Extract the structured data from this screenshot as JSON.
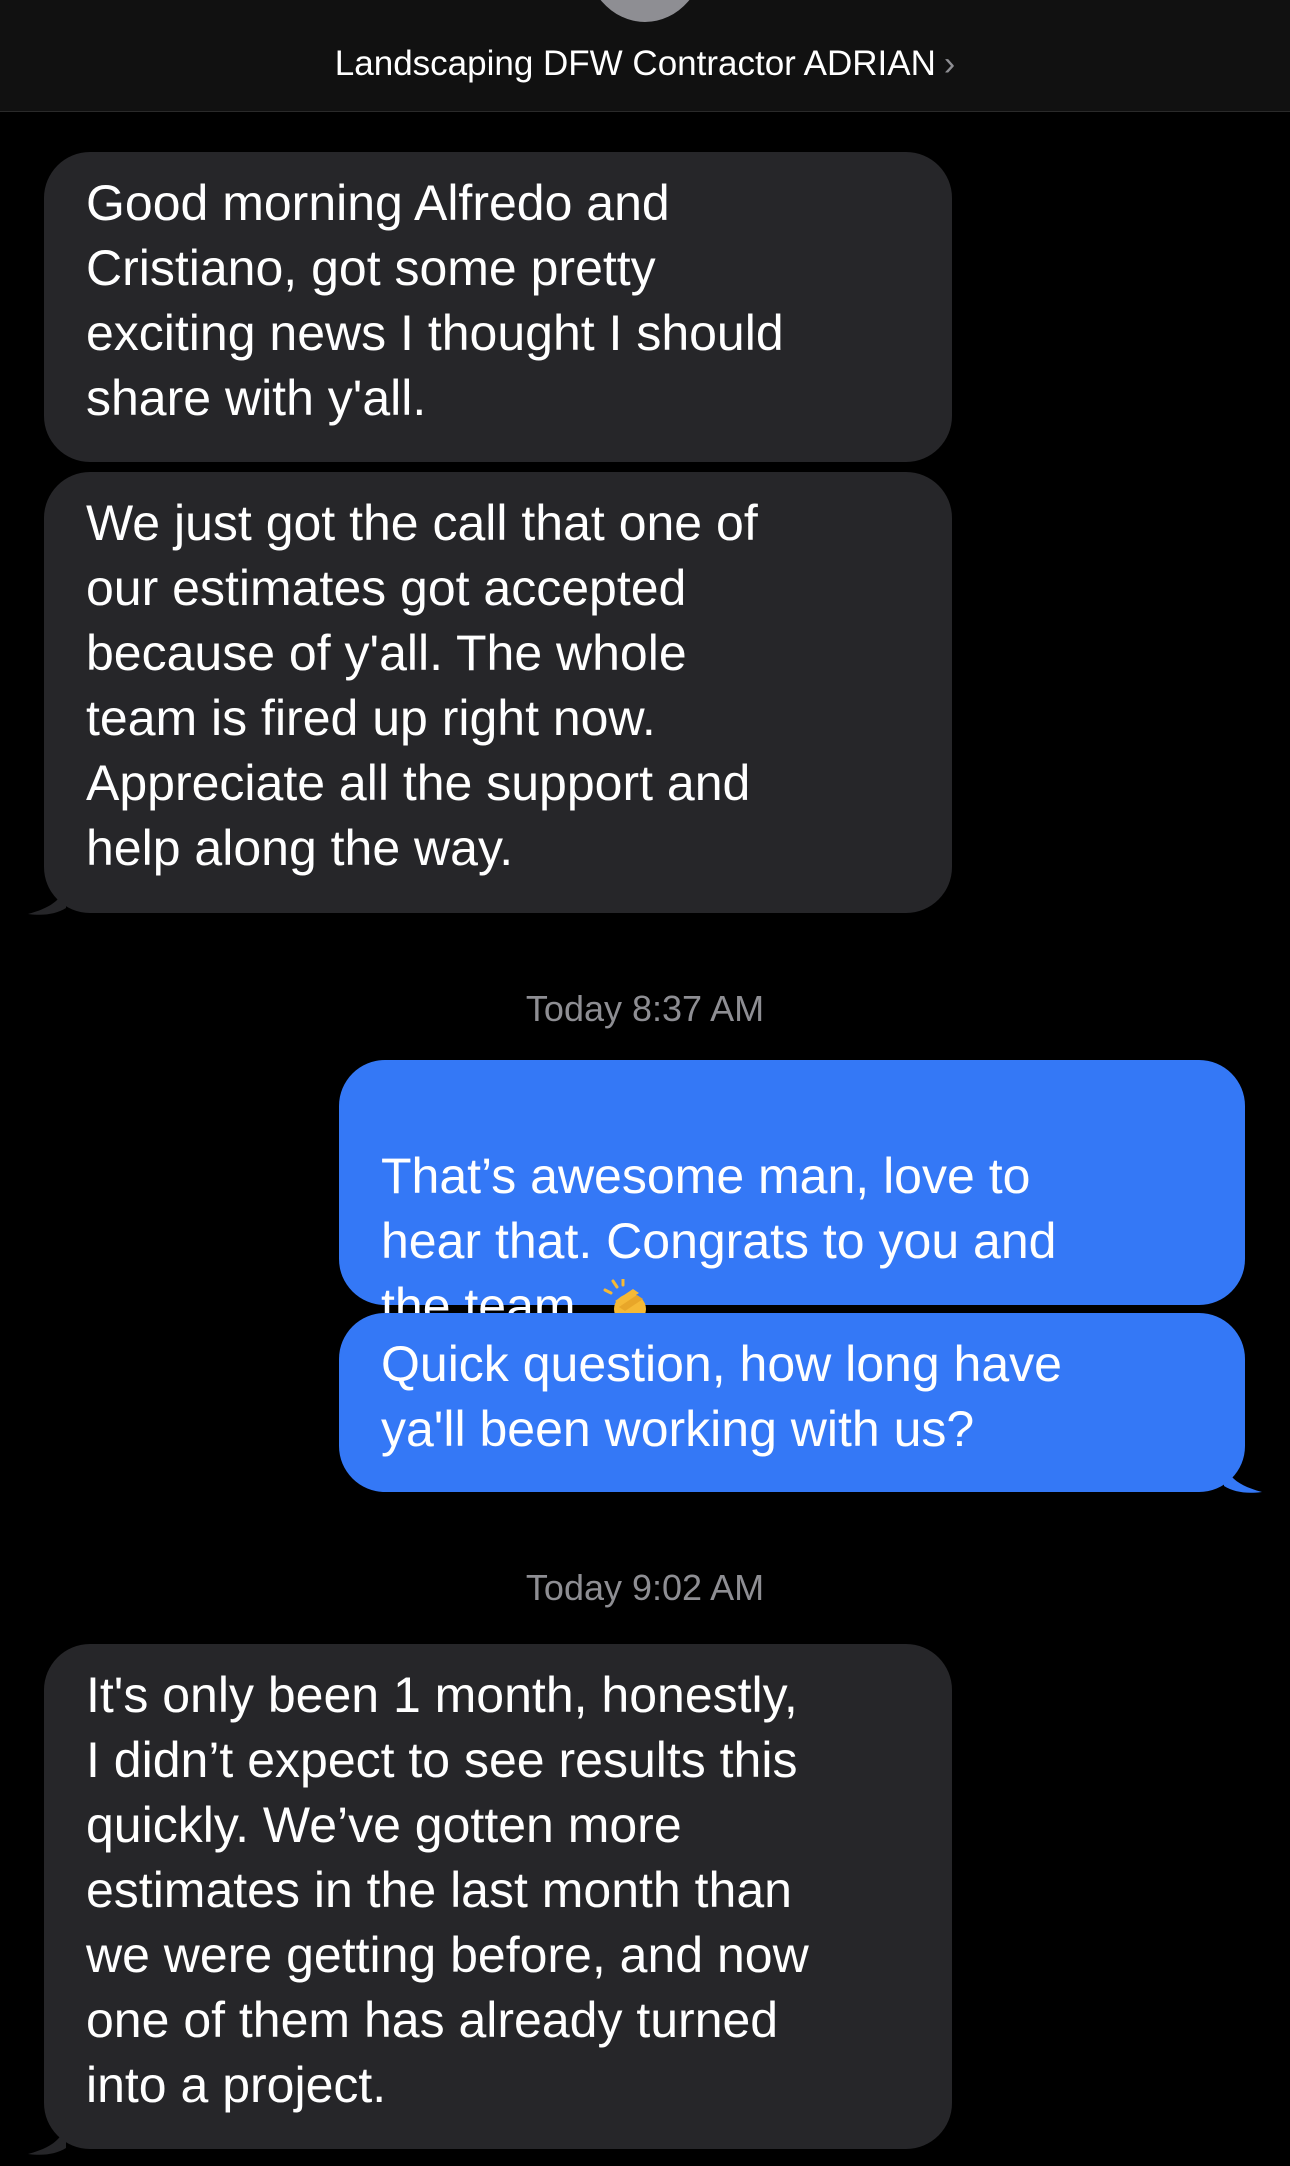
{
  "header": {
    "contact_name": "Landscaping DFW Contractor ADRIAN",
    "chevron": "›"
  },
  "messages": [
    {
      "direction": "incoming",
      "text": "Good morning Alfredo and\nCristiano, got some pretty\nexciting news I thought I should\nshare with y'all."
    },
    {
      "direction": "incoming",
      "text": "We just got the call that one of\nour estimates got accepted\nbecause of y'all. The whole\nteam is fired up right now.\nAppreciate all the support and\nhelp along the way."
    },
    {
      "timestamp": "Today 8:37 AM"
    },
    {
      "direction": "outgoing",
      "text": "That’s awesome man, love to\nhear that. Congrats to you and\nthe team.",
      "emoji": "clapping-hands-icon"
    },
    {
      "direction": "outgoing",
      "text": "Quick question, how long have\nya'll been working with us?"
    },
    {
      "timestamp": "Today 9:02 AM"
    },
    {
      "direction": "incoming",
      "text": "It's only been 1 month, honestly,\nI didn’t expect to see results this\nquickly. We’ve gotten more\nestimates in the last month than\nwe were getting before, and now\none of them has already turned\ninto a project."
    }
  ],
  "colors": {
    "background": "#000000",
    "incoming_bubble": "#262629",
    "outgoing_bubble": "#3478f6",
    "timestamp_text": "#8e8e93"
  }
}
